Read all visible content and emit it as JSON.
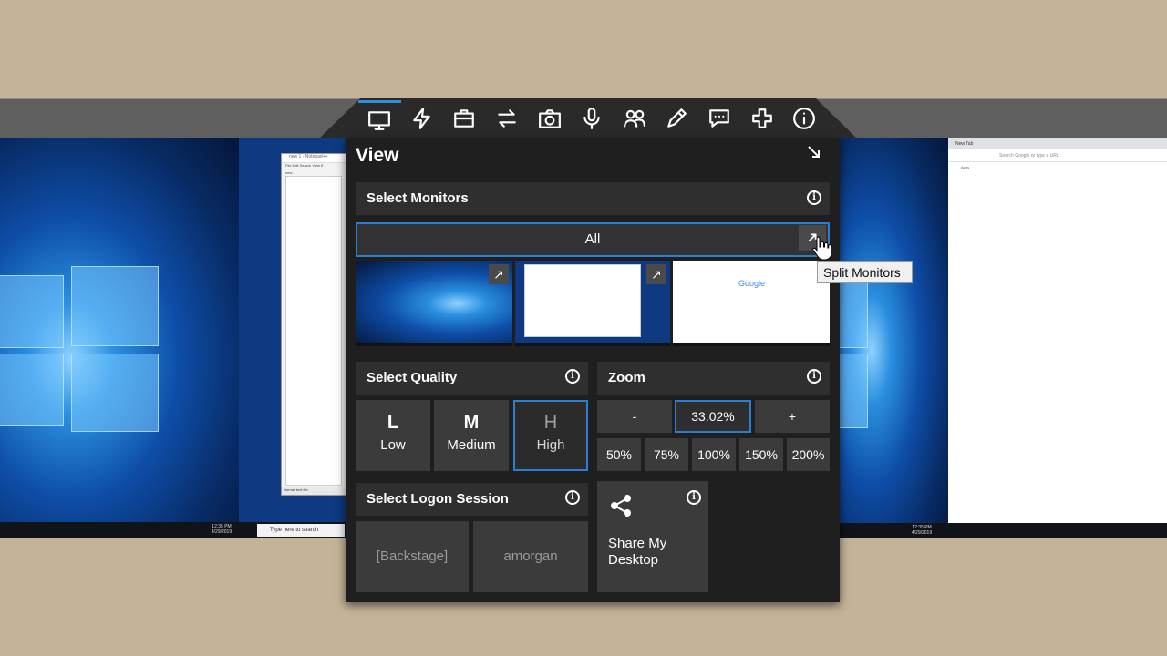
{
  "toolbar": {
    "active": "view",
    "icons": [
      "monitor-icon",
      "lightning-icon",
      "briefcase-icon",
      "swap-arrows-icon",
      "camera-icon",
      "microphone-icon",
      "people-icon",
      "pencil-icon",
      "chat-icon",
      "plus-icon",
      "info-icon"
    ]
  },
  "panel": {
    "title": "View",
    "collapse_icon": "arrow-down-right-icon"
  },
  "monitors": {
    "heading": "Select Monitors",
    "all_label": "All",
    "split_tooltip": "Split Monitors",
    "thumbnails": [
      "Monitor 1",
      "Monitor 2",
      "Monitor 3"
    ]
  },
  "quality": {
    "heading": "Select Quality",
    "options": [
      {
        "letter": "L",
        "label": "Low"
      },
      {
        "letter": "M",
        "label": "Medium"
      },
      {
        "letter": "H",
        "label": "High"
      }
    ],
    "selected": "High"
  },
  "zoom": {
    "heading": "Zoom",
    "minus": "-",
    "value": "33.02%",
    "plus": "+",
    "presets": [
      "50%",
      "75%",
      "100%",
      "150%",
      "200%"
    ]
  },
  "logon": {
    "heading": "Select Logon Session",
    "sessions": [
      "[Backstage]",
      "amorgan"
    ]
  },
  "share": {
    "label": "Share My Desktop"
  },
  "remote_desktop": {
    "notepad_title": "new 1 - Notepad++",
    "notepad_menu": "File  Edit  Search  View  E",
    "notepad_tab": "new 1",
    "notepad_status": "Normal text file",
    "left_clock": "12:35 PM\n4/29/2019",
    "search_placeholder": "Type here to search",
    "chrome_tab": "New Tab",
    "chrome_address": "Search Google or type a URL",
    "chrome_apps": "Apps",
    "right_clock": "12:35 PM\n4/29/2019"
  },
  "colors": {
    "accent": "#2a7fd4",
    "panel_bg": "#1f1f1f",
    "button_bg": "#3b3b3b",
    "background": "#c4b397"
  }
}
